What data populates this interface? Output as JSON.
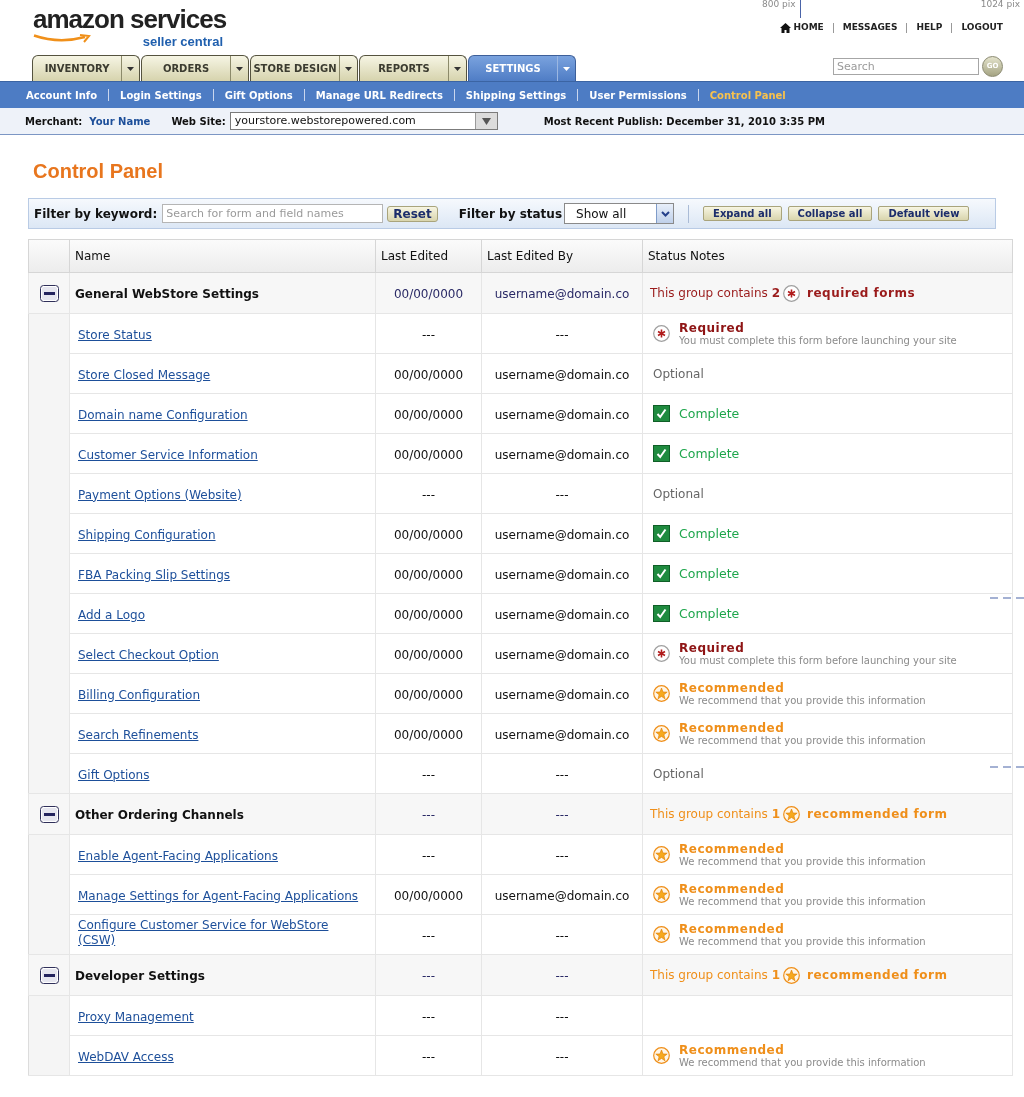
{
  "header": {
    "logo": {
      "wordmark": "amazon services",
      "tagline": "seller central"
    },
    "ruler_marks": [
      "800 pix",
      "1024 pix"
    ],
    "top_links": [
      {
        "kind": "home",
        "label": "HOME"
      },
      {
        "kind": "plain",
        "label": "MESSAGES"
      },
      {
        "kind": "plain",
        "label": "HELP"
      },
      {
        "kind": "plain",
        "label": "LOGOUT"
      }
    ],
    "search": {
      "placeholder": "Search",
      "button": "GO"
    }
  },
  "tabs": [
    {
      "label": "INVENTORY",
      "selected": false
    },
    {
      "label": "ORDERS",
      "selected": false
    },
    {
      "label": "STORE DESIGN",
      "selected": false
    },
    {
      "label": "REPORTS",
      "selected": false
    },
    {
      "label": "SETTINGS",
      "selected": true
    }
  ],
  "subnav": [
    {
      "label": "Account Info",
      "selected": false
    },
    {
      "label": "Login Settings",
      "selected": false
    },
    {
      "label": "Gift Options",
      "selected": false
    },
    {
      "label": "Manage URL Redirects",
      "selected": false
    },
    {
      "label": "Shipping Settings",
      "selected": false
    },
    {
      "label": "User Permissions",
      "selected": false
    },
    {
      "label": "Control Panel",
      "selected": true
    }
  ],
  "merchant_bar": {
    "merchant_label": "Merchant:",
    "merchant_name": "Your Name",
    "website_label": "Web Site:",
    "website_value": "yourstore.webstorepowered.com",
    "publish": "Most Recent Publish: December 31, 2010 3:35 PM"
  },
  "page_title": "Control Panel",
  "filter_bar": {
    "keyword_label": "Filter by keyword:",
    "keyword_placeholder": "Search for form and field names",
    "reset": "Reset",
    "status_label": "Filter by status",
    "status_value": "Show all",
    "buttons": [
      "Expand all",
      "Collapse all",
      "Default view"
    ]
  },
  "table": {
    "columns": [
      "Name",
      "Last Edited",
      "Last Edited By",
      "Status Notes"
    ],
    "groups": [
      {
        "name": "General WebStore Settings",
        "expanded": true,
        "last_edited": "00/00/0000",
        "last_edited_by": "username@domain.co",
        "summary": {
          "kind": "required",
          "prefix": "This group contains",
          "count": "2",
          "suffix": "required forms"
        },
        "children": [
          {
            "name": "Store Status",
            "last_edited": "---",
            "last_edited_by": "---",
            "status": {
              "kind": "required",
              "label": "Required",
              "note": "You must complete this form before launching your site"
            }
          },
          {
            "name": "Store Closed Message",
            "last_edited": "00/00/0000",
            "last_edited_by": "username@domain.co",
            "status": {
              "kind": "optional",
              "label": "Optional"
            }
          },
          {
            "name": "Domain name Configuration",
            "last_edited": "00/00/0000",
            "last_edited_by": "username@domain.co",
            "status": {
              "kind": "complete",
              "label": "Complete"
            }
          },
          {
            "name": "Customer Service Information",
            "last_edited": "00/00/0000",
            "last_edited_by": "username@domain.co",
            "status": {
              "kind": "complete",
              "label": "Complete"
            }
          },
          {
            "name": "Payment Options (Website)",
            "last_edited": "---",
            "last_edited_by": "---",
            "status": {
              "kind": "optional",
              "label": "Optional"
            }
          },
          {
            "name": "Shipping Configuration",
            "last_edited": "00/00/0000",
            "last_edited_by": "username@domain.co",
            "status": {
              "kind": "complete",
              "label": "Complete"
            }
          },
          {
            "name": "FBA Packing Slip Settings",
            "last_edited": "00/00/0000",
            "last_edited_by": "username@domain.co",
            "status": {
              "kind": "complete",
              "label": "Complete"
            }
          },
          {
            "name": "Add a Logo",
            "last_edited": "00/00/0000",
            "last_edited_by": "username@domain.co",
            "status": {
              "kind": "complete",
              "label": "Complete"
            }
          },
          {
            "name": "Select Checkout Option",
            "last_edited": "00/00/0000",
            "last_edited_by": "username@domain.co",
            "status": {
              "kind": "required",
              "label": "Required",
              "note": "You must complete this form before launching your site"
            }
          },
          {
            "name": "Billing Configuration",
            "last_edited": "00/00/0000",
            "last_edited_by": "username@domain.co",
            "status": {
              "kind": "recommended",
              "label": "Recommended",
              "note": "We recommend that you provide this information"
            }
          },
          {
            "name": "Search Refinements",
            "last_edited": "00/00/0000",
            "last_edited_by": "username@domain.co",
            "status": {
              "kind": "recommended",
              "label": "Recommended",
              "note": "We recommend that you provide this information"
            }
          },
          {
            "name": "Gift Options",
            "last_edited": "---",
            "last_edited_by": "---",
            "status": {
              "kind": "optional",
              "label": "Optional"
            }
          }
        ]
      },
      {
        "name": "Other Ordering Channels",
        "expanded": true,
        "last_edited": "---",
        "last_edited_by": "---",
        "summary": {
          "kind": "recommended",
          "prefix": "This group contains",
          "count": "1",
          "suffix": "recommended form"
        },
        "children": [
          {
            "name": "Enable Agent-Facing Applications",
            "last_edited": "---",
            "last_edited_by": "---",
            "status": {
              "kind": "recommended",
              "label": "Recommended",
              "note": "We recommend that you provide this information"
            }
          },
          {
            "name": "Manage Settings for Agent-Facing Applications",
            "last_edited": "00/00/0000",
            "last_edited_by": "username@domain.co",
            "status": {
              "kind": "recommended",
              "label": "Recommended",
              "note": "We recommend that you provide this information"
            }
          },
          {
            "name": "Configure Customer Service for WebStore (CSW)",
            "last_edited": "---",
            "last_edited_by": "---",
            "status": {
              "kind": "recommended",
              "label": "Recommended",
              "note": "We recommend that you provide this information"
            }
          }
        ]
      },
      {
        "name": "Developer Settings",
        "expanded": true,
        "last_edited": "---",
        "last_edited_by": "---",
        "summary": {
          "kind": "recommended",
          "prefix": "This group contains",
          "count": "1",
          "suffix": "recommended form"
        },
        "children": [
          {
            "name": "Proxy Management",
            "last_edited": "---",
            "last_edited_by": "---"
          },
          {
            "name": "WebDAV Access",
            "last_edited": "---",
            "last_edited_by": "---",
            "status": {
              "kind": "recommended",
              "label": "Recommended",
              "note": "We recommend that you provide this information"
            }
          }
        ]
      }
    ]
  }
}
